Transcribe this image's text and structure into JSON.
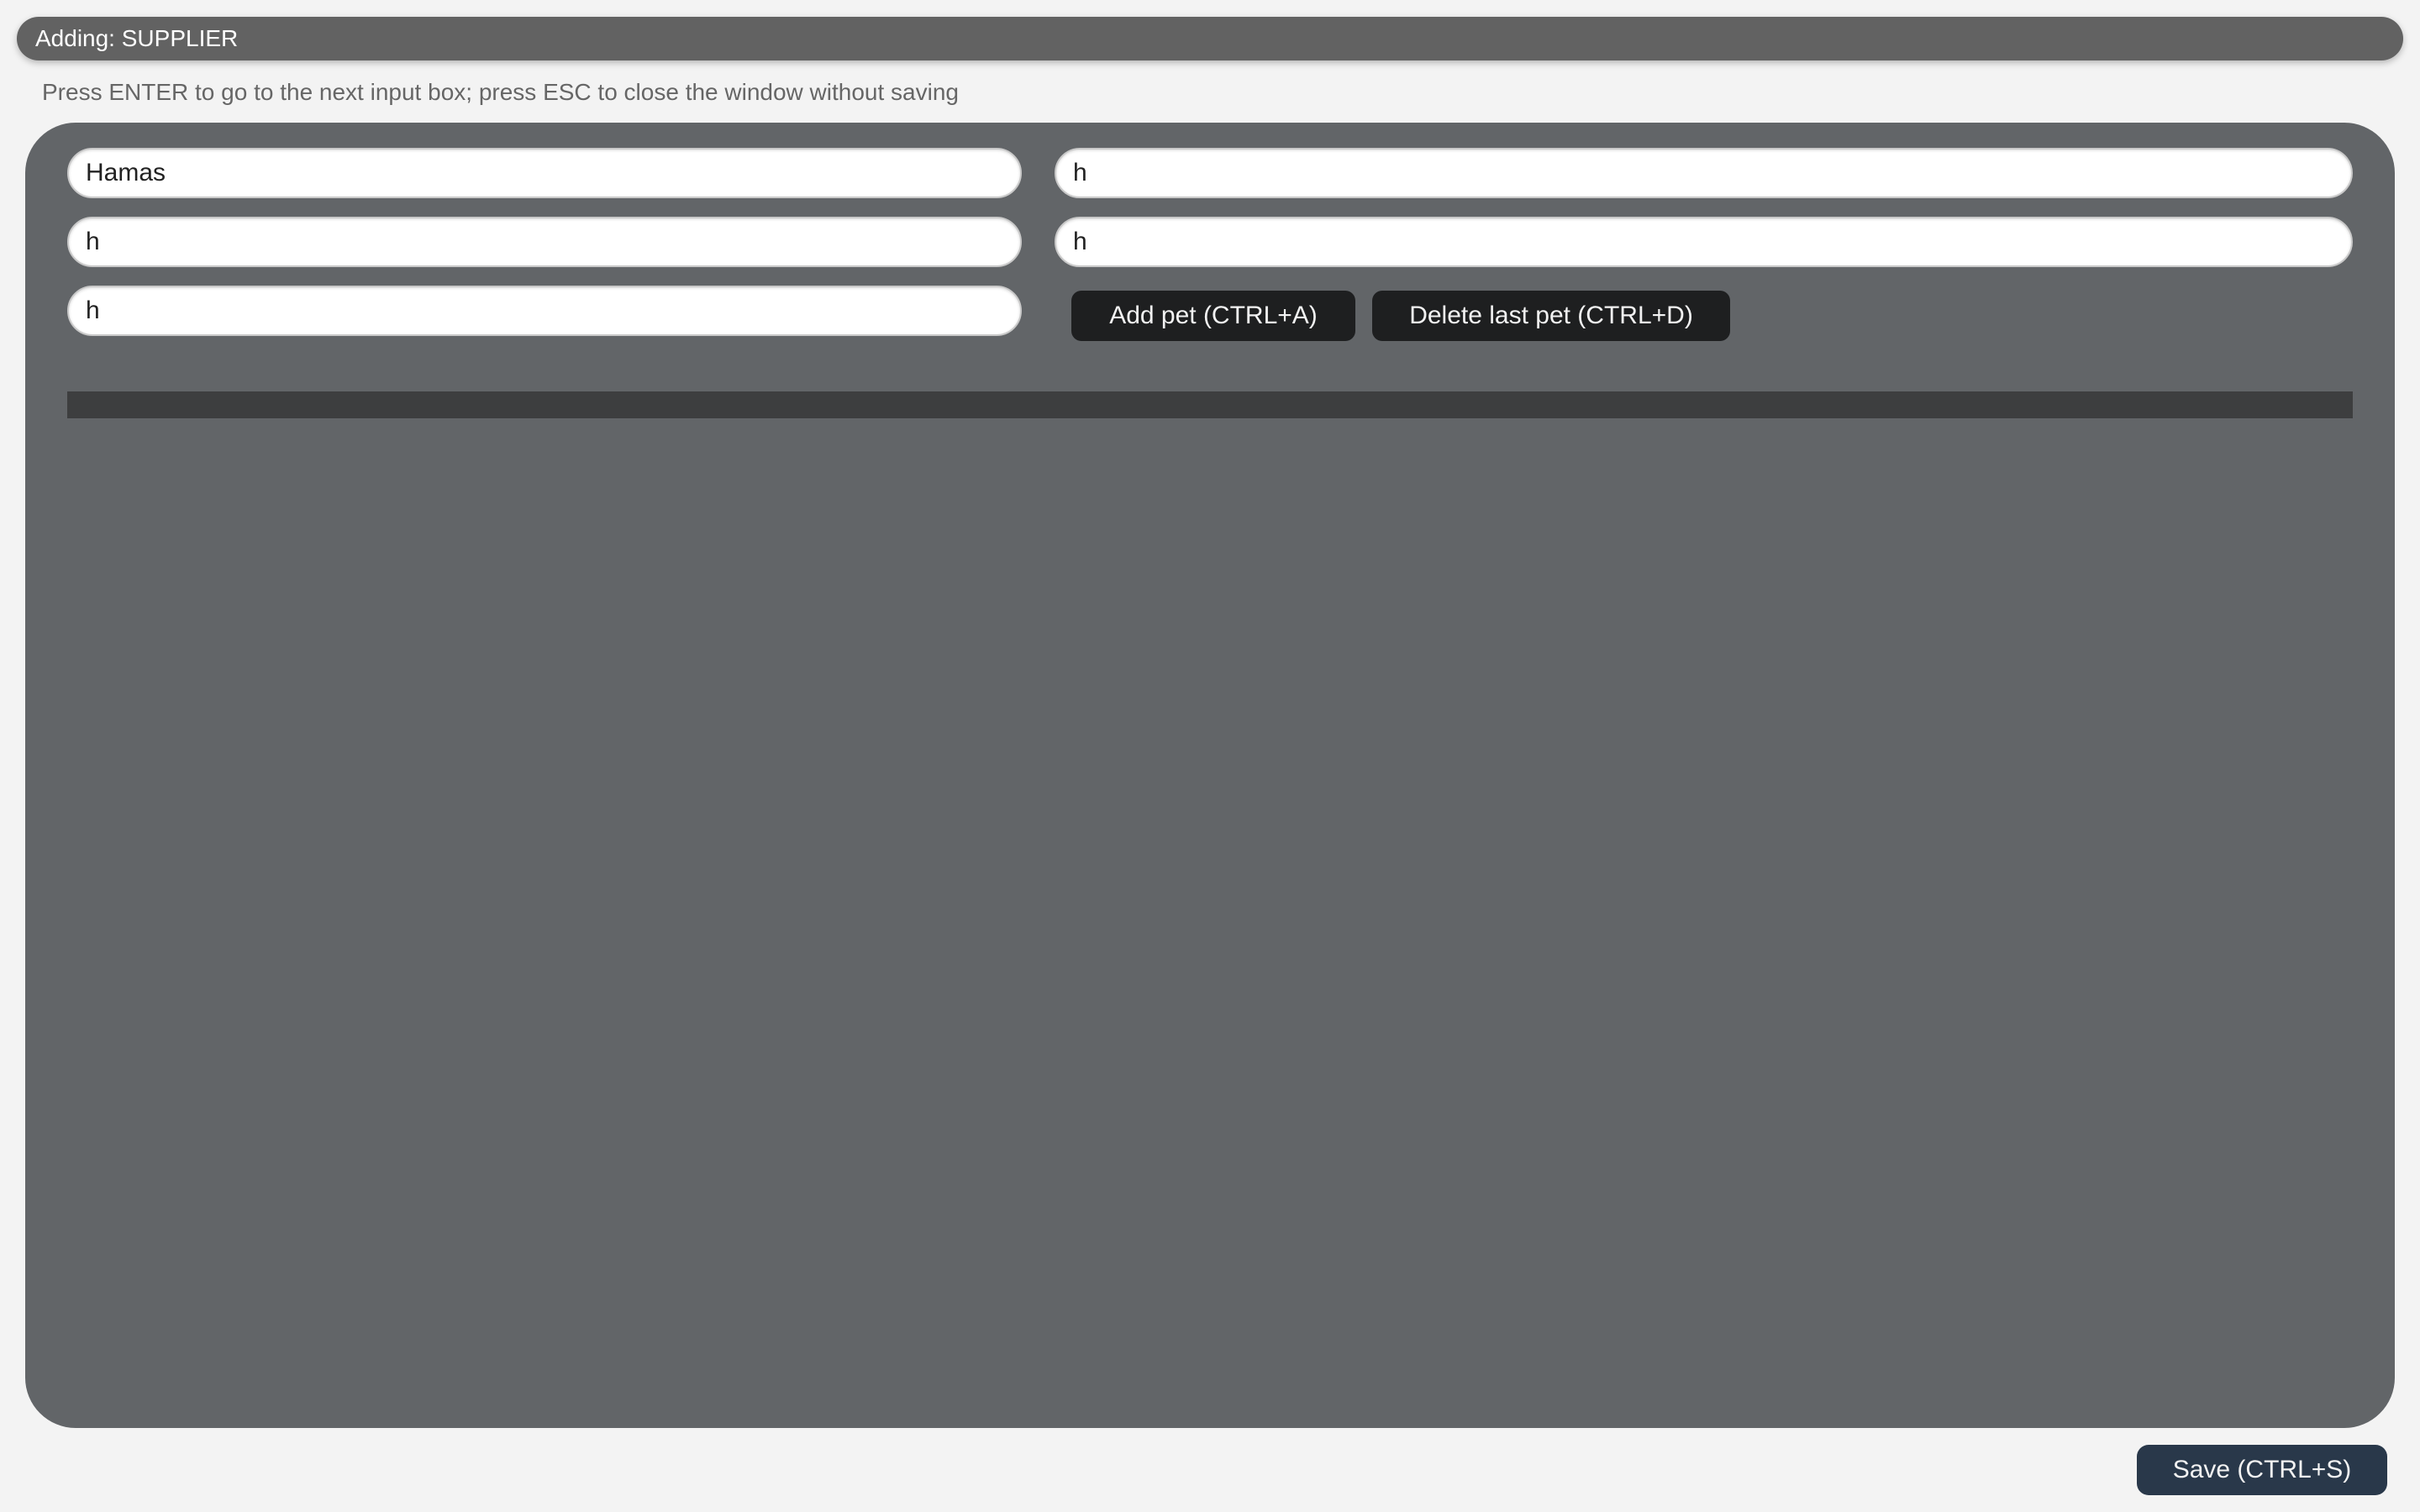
{
  "window": {
    "title": "Adding: SUPPLIER"
  },
  "hint": "Press ENTER to go to the next input box; press ESC to close the window without saving",
  "form": {
    "fields": [
      {
        "value": "Hamas"
      },
      {
        "value": "h"
      },
      {
        "value": "h"
      },
      {
        "value": "h"
      },
      {
        "value": "h"
      }
    ],
    "add_pet_label": "Add pet (CTRL+A)",
    "delete_pet_label": "Delete last pet (CTRL+D)"
  },
  "pets_table": {
    "rows": []
  },
  "save_label": "Save (CTRL+S)",
  "colors": {
    "background": "#f3f3f3",
    "title_bar": "#626262",
    "panel": "#626568",
    "button_dark": "#1e1f20",
    "table_header": "#3d3e3f",
    "save_button": "#29384a"
  }
}
